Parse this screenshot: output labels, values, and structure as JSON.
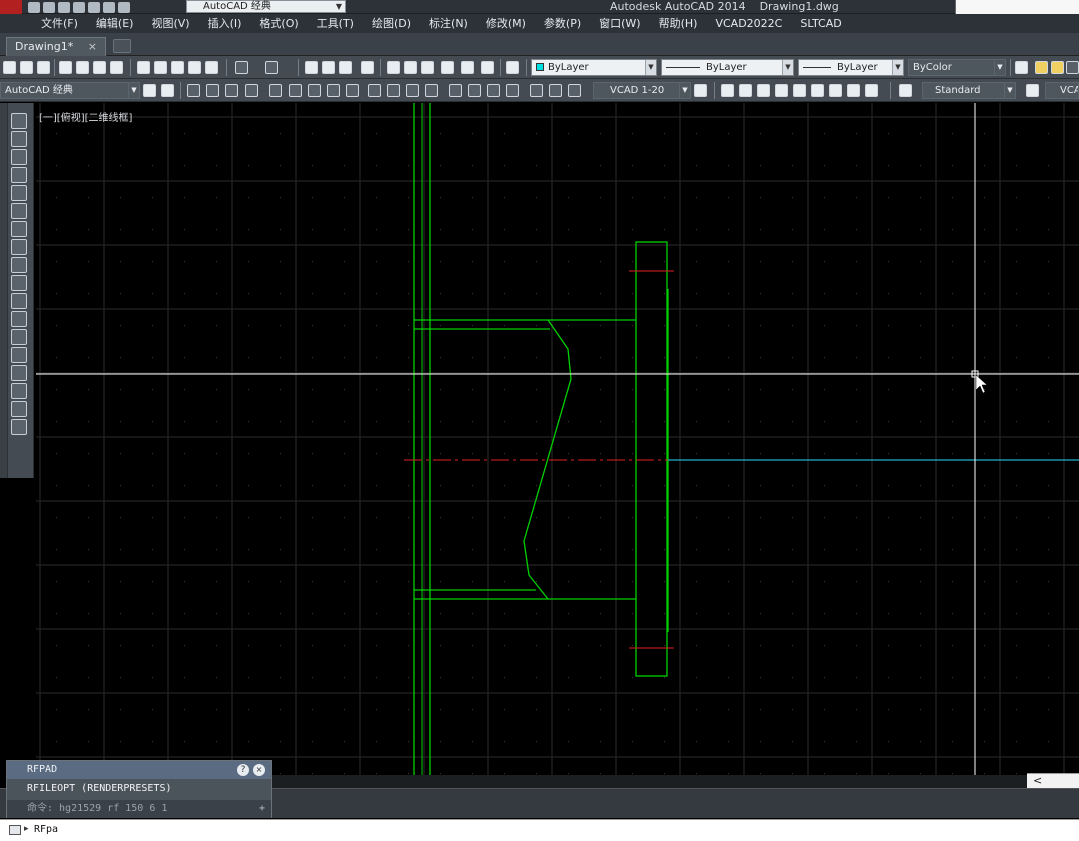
{
  "window": {
    "title": "Autodesk AutoCAD 2014    Drawing1.dwg",
    "workspace": "AutoCAD 经典"
  },
  "menu": [
    "文件(F)",
    "编辑(E)",
    "视图(V)",
    "插入(I)",
    "格式(O)",
    "工具(T)",
    "绘图(D)",
    "标注(N)",
    "修改(M)",
    "参数(P)",
    "窗口(W)",
    "帮助(H)",
    "VCAD2022C",
    "SLTCAD"
  ],
  "tabs": {
    "drawing": "Drawing1*",
    "close": "×"
  },
  "properties": {
    "layer": "ByLayer",
    "linetype": "ByLayer",
    "lineweight": "ByLayer",
    "plotstyle": "ByColor"
  },
  "toolbar2": {
    "workspace": "AutoCAD 经典",
    "dimstyle": "VCAD 1-20",
    "textstyle": "Standard",
    "extra": "VCA"
  },
  "viewport": {
    "label": "[一][俯视][二维线框]",
    "colors": {
      "background": "#000000",
      "grid": "#2b2b2b",
      "outline": "#00d000",
      "centerline": "#e02020",
      "axis": "#20b0c8",
      "crosshair": "#ffffff"
    }
  },
  "command": {
    "history_1": "RFPAD",
    "history_2": "RFILEOPT (RENDERPRESETS)",
    "history_3": "命令: hg21529 rf 150 6 1",
    "input": "RFpa",
    "help": "?",
    "close": "×",
    "expand": "+",
    "prompt_caret": "▸"
  },
  "scrollbar": {
    "arrow": "<"
  },
  "icons": {
    "app": "autocad-logo-icon",
    "quick_access": [
      "new-icon",
      "open-icon",
      "save-icon",
      "saveas-icon",
      "plot-icon",
      "undo-icon",
      "redo-icon"
    ]
  }
}
